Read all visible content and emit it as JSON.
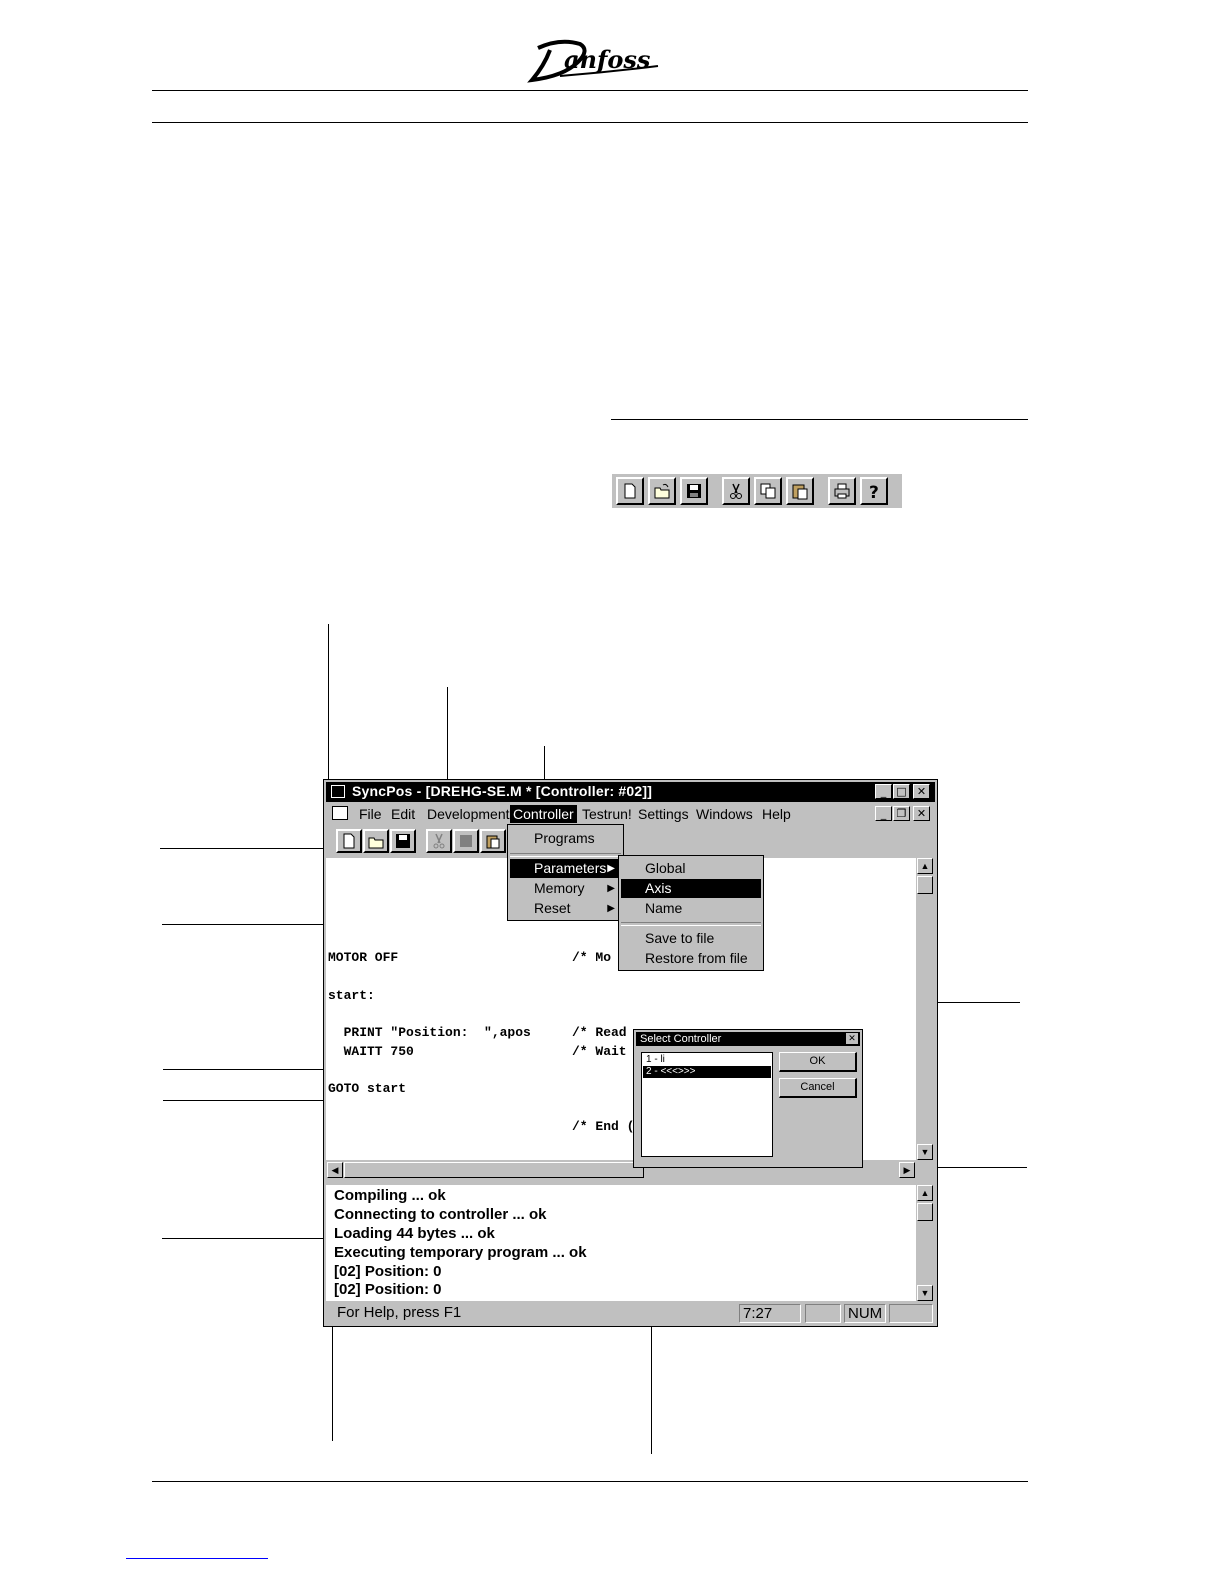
{
  "brand": {
    "logo_text": "Danfoss"
  },
  "window": {
    "title": "SyncPos - [DREHG-SE.M * [Controller: #02]]",
    "menu": [
      {
        "label": "File"
      },
      {
        "label": "Edit"
      },
      {
        "label": "Development"
      },
      {
        "label": "Controller"
      },
      {
        "label": "Testrun!"
      },
      {
        "label": "Settings"
      },
      {
        "label": "Windows"
      },
      {
        "label": "Help"
      }
    ],
    "toolbar_icons": [
      "new-file-icon",
      "open-folder-icon",
      "save-disk-icon",
      "cut-icon",
      "copy-icon",
      "paste-icon"
    ]
  },
  "controller_menu": {
    "items": [
      {
        "label": "Programs",
        "has_submenu": false
      },
      {
        "label": "Parameters",
        "has_submenu": true
      },
      {
        "label": "Memory",
        "has_submenu": true
      },
      {
        "label": "Reset",
        "has_submenu": true
      }
    ],
    "highlighted": "Parameters"
  },
  "parameters_submenu": {
    "items": [
      "Global",
      "Axis",
      "Name",
      "Save to file",
      "Restore from file"
    ],
    "highlighted": "Axis"
  },
  "editor": {
    "lines": [
      {
        "code": "MOTOR OFF",
        "comment": "/* Mo"
      },
      {
        "code": "start:",
        "comment": ""
      },
      {
        "code": "  PRINT \"Position:  \",apos",
        "comment": "/* Read"
      },
      {
        "code": "  WAITT 750",
        "comment": "/* Wait"
      },
      {
        "code": "GOTO start",
        "comment": ""
      },
      {
        "code": "",
        "comment": "/* End ("
      }
    ]
  },
  "output": {
    "lines": [
      "Compiling ... ok",
      "Connecting to controller ... ok",
      "Loading 44 bytes ... ok",
      "Executing temporary program ... ok",
      "[02] Position:  0",
      "[02] Position:  0"
    ]
  },
  "statusbar": {
    "help": "For Help, press F1",
    "time": "7:27",
    "num": "NUM"
  },
  "select_dialog": {
    "title": "Select Controller",
    "options": [
      "1 - li",
      "2 - <<<>>>"
    ],
    "selected": "2 - <<<>>>",
    "ok_label": "OK",
    "cancel_label": "Cancel"
  },
  "small_toolbar_icons": [
    "new-file-icon",
    "open-folder-icon",
    "save-disk-icon",
    "cut-icon",
    "copy-icon",
    "paste-icon",
    "print-icon",
    "help-icon"
  ]
}
